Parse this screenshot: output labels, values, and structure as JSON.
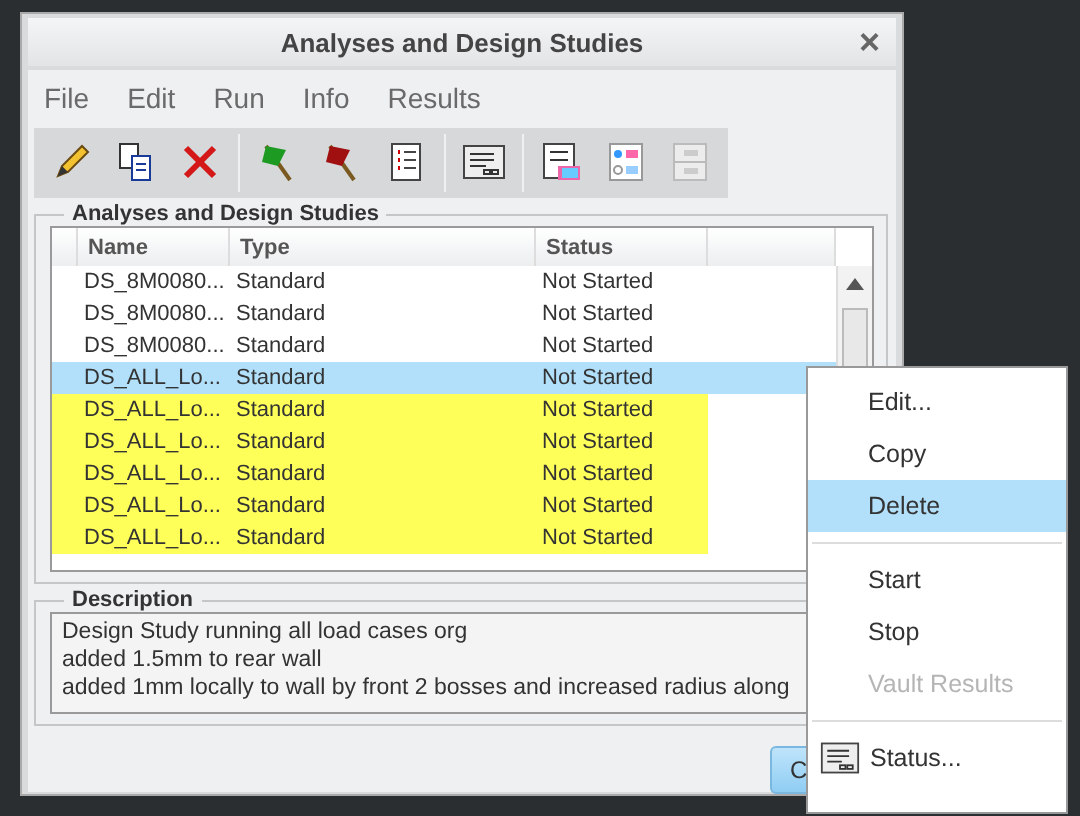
{
  "window": {
    "title": "Analyses and Design Studies",
    "close": "×"
  },
  "menu": [
    "File",
    "Edit",
    "Run",
    "Info",
    "Results"
  ],
  "toolbar": [
    [
      {
        "kind": "pencil",
        "disabled": false
      },
      {
        "kind": "copy",
        "disabled": false
      },
      {
        "kind": "delete",
        "disabled": false
      }
    ],
    [
      {
        "kind": "flag-green",
        "disabled": false
      },
      {
        "kind": "flag-red",
        "disabled": false
      },
      {
        "kind": "list",
        "disabled": false
      }
    ],
    [
      {
        "kind": "status",
        "disabled": false
      }
    ],
    [
      {
        "kind": "color-list",
        "disabled": false
      },
      {
        "kind": "options",
        "disabled": false
      },
      {
        "kind": "options",
        "disabled": true
      }
    ]
  ],
  "studies": {
    "title": "Analyses and Design Studies",
    "columns": [
      "Name",
      "Type",
      "Status"
    ],
    "rows": [
      {
        "name": "DS_8M0080...",
        "type": "Standard",
        "status": "Not Started",
        "selected": false,
        "highlighted": false
      },
      {
        "name": "DS_8M0080...",
        "type": "Standard",
        "status": "Not Started",
        "selected": false,
        "highlighted": false
      },
      {
        "name": "DS_8M0080...",
        "type": "Standard",
        "status": "Not Started",
        "selected": false,
        "highlighted": false
      },
      {
        "name": "DS_ALL_Lo...",
        "type": "Standard",
        "status": "Not Started",
        "selected": true,
        "highlighted": false
      },
      {
        "name": "DS_ALL_Lo...",
        "type": "Standard",
        "status": "Not Started",
        "selected": false,
        "highlighted": true
      },
      {
        "name": "DS_ALL_Lo...",
        "type": "Standard",
        "status": "Not Started",
        "selected": false,
        "highlighted": true
      },
      {
        "name": "DS_ALL_Lo...",
        "type": "Standard",
        "status": "Not Started",
        "selected": false,
        "highlighted": true
      },
      {
        "name": "DS_ALL_Lo...",
        "type": "Standard",
        "status": "Not Started",
        "selected": false,
        "highlighted": true
      },
      {
        "name": "DS_ALL_Lo...",
        "type": "Standard",
        "status": "Not Started",
        "selected": false,
        "highlighted": true
      }
    ]
  },
  "description": {
    "title": "Description",
    "lines": [
      "Design Study running all load cases org",
      "added 1.5mm to rear wall",
      "added 1mm locally to wall by front 2 bosses and increased radius along"
    ]
  },
  "button": "C",
  "context_menu": [
    {
      "kind": "item",
      "label": "Edit...",
      "selected": false,
      "disabled": false
    },
    {
      "kind": "item",
      "label": "Copy",
      "selected": false,
      "disabled": false
    },
    {
      "kind": "item",
      "label": "Delete",
      "selected": true,
      "disabled": false
    },
    {
      "kind": "separator"
    },
    {
      "kind": "item",
      "label": "Start",
      "selected": false,
      "disabled": false
    },
    {
      "kind": "item",
      "label": "Stop",
      "selected": false,
      "disabled": false
    },
    {
      "kind": "item",
      "label": "Vault Results",
      "selected": false,
      "disabled": true
    },
    {
      "kind": "separator"
    },
    {
      "kind": "status-item",
      "label": "Status...",
      "selected": false,
      "disabled": false
    }
  ]
}
